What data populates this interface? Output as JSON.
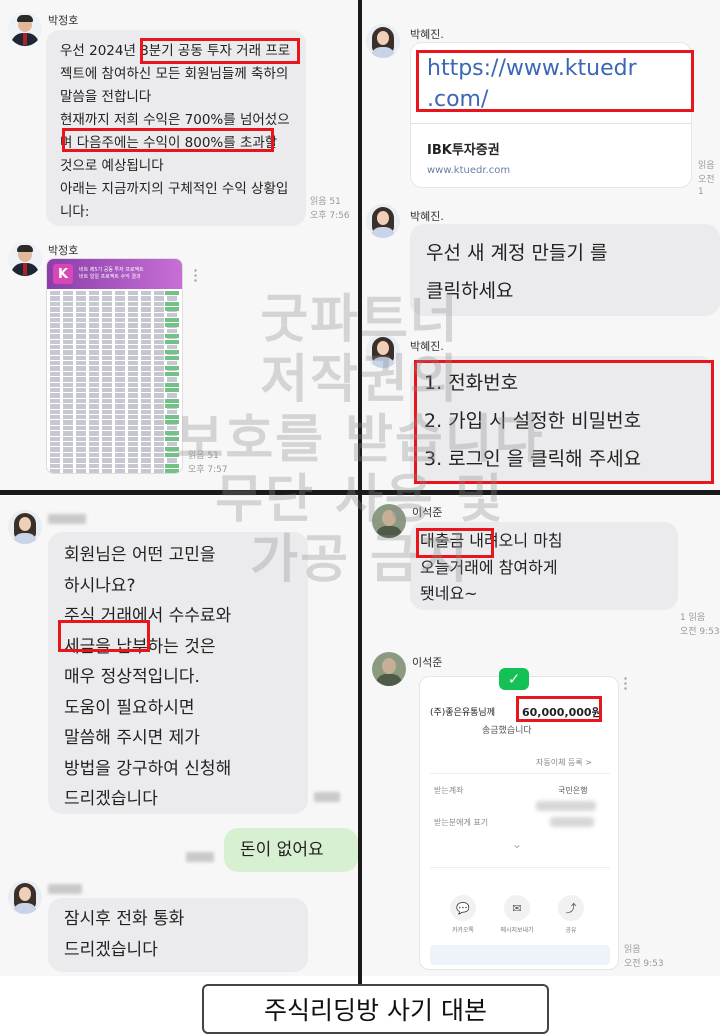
{
  "top_left": {
    "sender1": "박정호",
    "message1": "우선 2024년 3분기 공동 투자 거래 프로\n젝트에 참여하신 모든 회원님들께 축하의\n말씀을 전합니다\n현재까지 저희 수익은 700%를 넘어섰으\n며 다음주에는 수익이 800%를 초과할\n것으로 예상됩니다\n아래는 지금까지의 구체적인 수익 상황입\n니다:",
    "message1_read": "읽음 51",
    "message1_time": "오후 7:56",
    "sender2": "박정호",
    "image_title": "비트 제5기 공동 투자 프로젝트\n비트 일일 프로젝트 수익 결과",
    "image_logo": "K",
    "message2_read": "읽음 51",
    "message2_time": "오후 7:57"
  },
  "top_right": {
    "sender1": "박혜진.",
    "link_url": "https://www.ktuedr\n.com/",
    "link_name": "IBK투자증권",
    "link_domain": "www.ktuedr.com",
    "link_read": "읽음",
    "link_time": "오전 1",
    "sender2": "박혜진.",
    "message2": "우선 새 계정 만들기 를\n클릭하세요",
    "sender3": "박혜진.",
    "message3": "1. 전화번호\n2. 가입 시 설정한 비밀번호\n3. 로그인 을 클릭해 주세요"
  },
  "bottom_left": {
    "message1": "회원님은 어떤 고민을\n하시나요?\n주식 거래에서 수수료와\n세금을 납부하는 것은\n매우 정상적입니다.\n도움이 필요하시면\n말씀해 주시면 제가\n방법을 강구하여 신청해\n드리겠습니다",
    "reply": "돈이 없어요",
    "message2": "잠시후 전화 통화\n드리겠습니다"
  },
  "bottom_right": {
    "sender1": "이석준",
    "message1": "대출금 내려오니 마침\n오늘거래에 참여하게\n됏네요~",
    "message1_read": "1 읽음",
    "message1_time": "오전 9:53",
    "sender2": "이석준",
    "receipt_recipient": "(주)좋은유통님께",
    "receipt_amount": "60,000,000원",
    "receipt_sent": "송금했습니다",
    "receipt_autotransfer": "자동이체 등록 >",
    "receipt_account_label": "받는계좌",
    "receipt_bank": "국민은행",
    "receipt_memo_label": "받는분에게 표기",
    "receipt_buttons": [
      "카카오톡",
      "메시지보내기",
      "공유"
    ],
    "message2_read": "읽음",
    "message2_time": "오전 9:53"
  },
  "watermark": "굿파트너\n저작권의\n보호를 받습니다\n무단 사용 및\n가공 금지",
  "caption": "주식리딩방 사기 대본",
  "colors": {
    "highlight_box": "#e8151c",
    "bubble": "#ebebed",
    "my_bubble": "#d8f0d2",
    "link": "#3b67b5",
    "check": "#14c154"
  }
}
